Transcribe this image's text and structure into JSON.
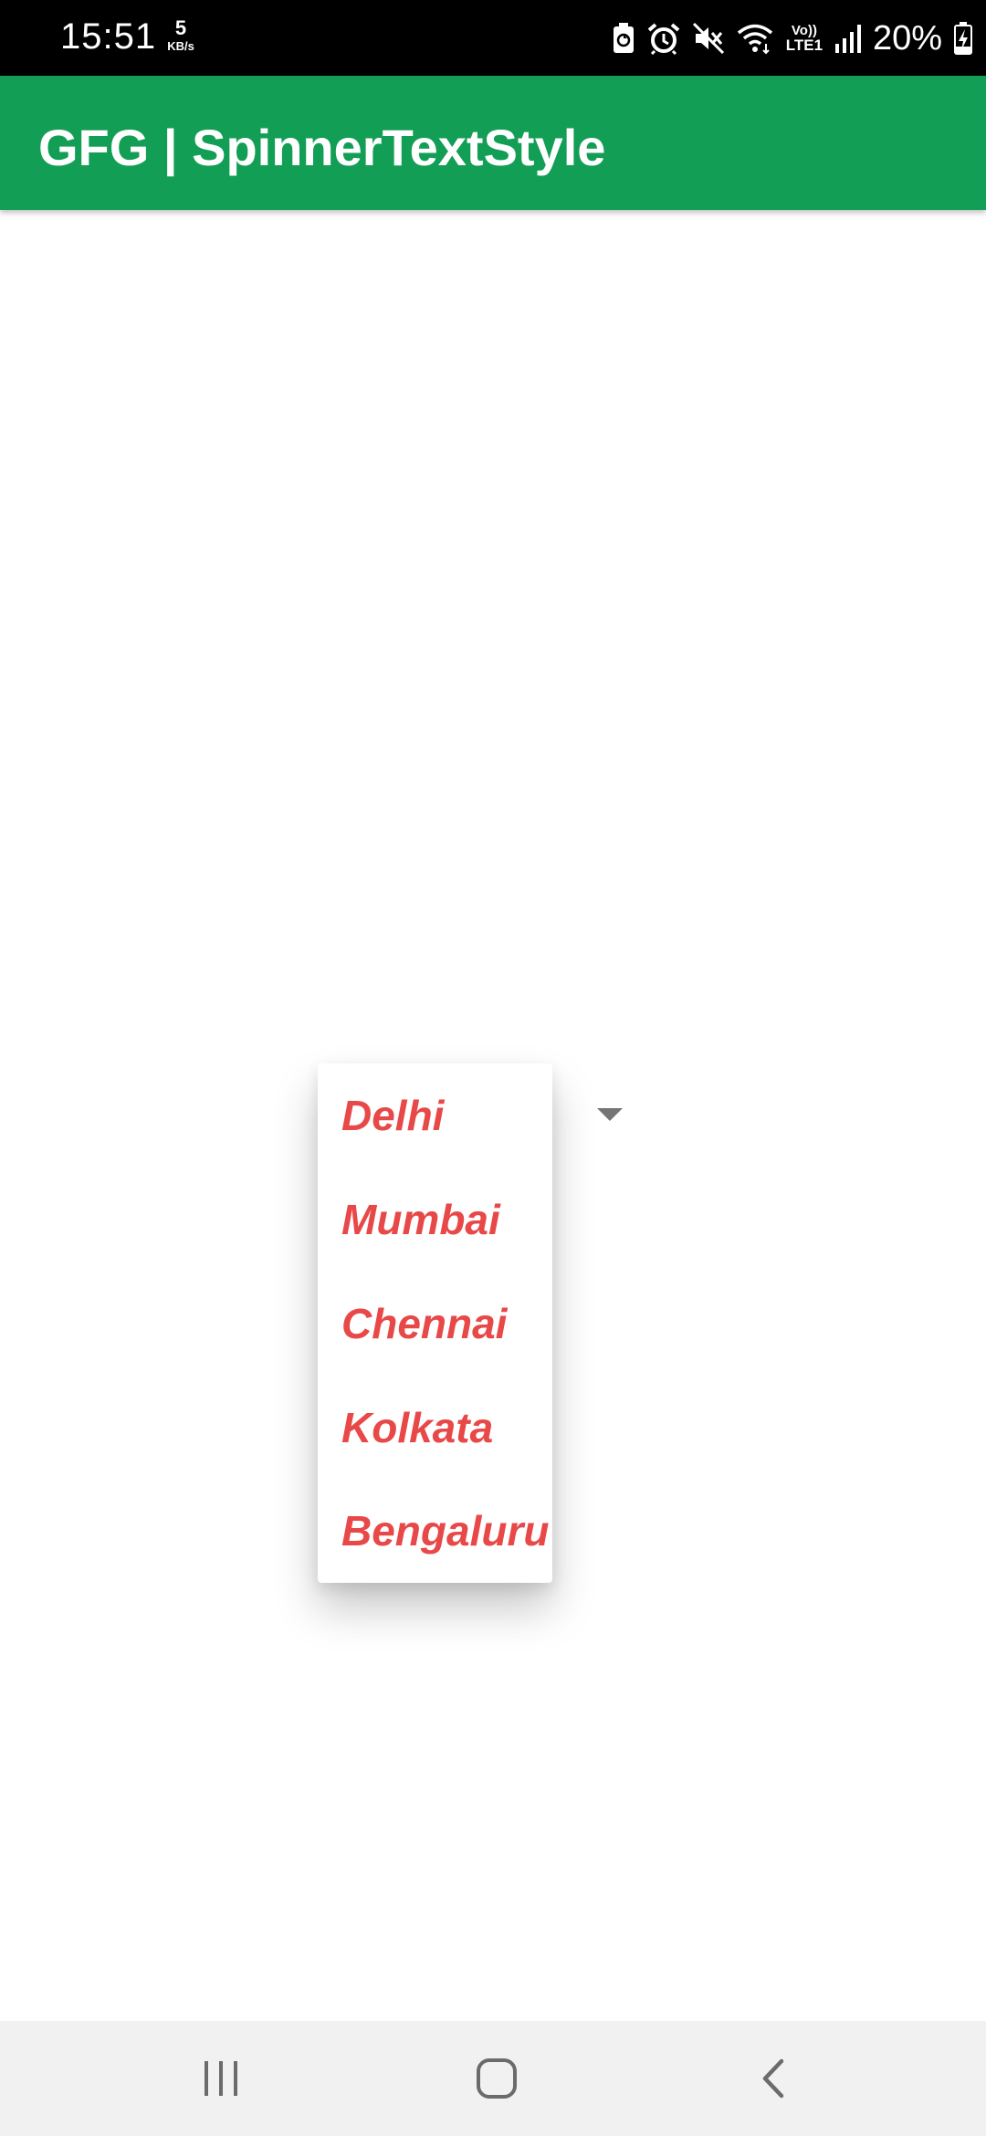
{
  "status_bar": {
    "time": "15:51",
    "net_speed_value": "5",
    "net_speed_unit": "KB/s",
    "network_label_top": "Vo))",
    "network_label_bottom": "LTE1",
    "battery_percent": "20%",
    "icons": [
      "battery-saver-icon",
      "alarm-icon",
      "mute-vibrate-icon",
      "wifi-icon",
      "volte-lte-icon",
      "signal-icon",
      "battery-charging-icon"
    ]
  },
  "app_bar": {
    "title": "GFG | SpinnerTextStyle",
    "color": "#139e55"
  },
  "spinner": {
    "arrow_icon": "dropdown-arrow-icon",
    "item_color": "#e84848",
    "options": [
      "Delhi",
      "Mumbai",
      "Chennai",
      "Kolkata",
      "Bengaluru"
    ]
  },
  "nav_bar": {
    "buttons": [
      "recent-apps-icon",
      "home-icon",
      "back-icon"
    ]
  }
}
